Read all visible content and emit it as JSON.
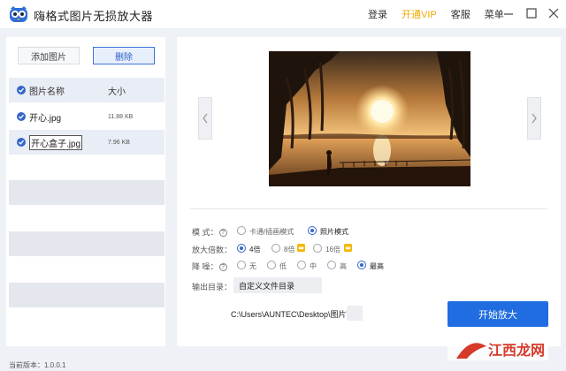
{
  "app": {
    "title": "嗨格式图片无损放大器",
    "nav": {
      "login": "登录",
      "vip": "开通VIP",
      "service": "客服",
      "menu": "菜单"
    }
  },
  "left": {
    "add_label": "添加图片",
    "delete_label": "删除",
    "header_name": "图片名称",
    "header_size": "大小",
    "files": [
      {
        "name": "开心.jpg",
        "size": "11.88 KB"
      },
      {
        "name": "开心盒子.jpg",
        "size": "7.96 KB"
      }
    ]
  },
  "options": {
    "mode_label": "模 式：",
    "mode_options": [
      "卡通/插画模式",
      "照片模式"
    ],
    "mode_selected": "照片模式",
    "scale_label": "放大倍数：",
    "scale_options": [
      "4倍",
      "8倍",
      "16倍"
    ],
    "scale_selected": "4倍",
    "noise_label": "降 噪：",
    "noise_options": [
      "无",
      "低",
      "中",
      "高",
      "最高"
    ],
    "noise_selected": "最高",
    "output_label": "输出目录：",
    "output_btn": "自定义文件目录",
    "output_path": "C:\\Users\\AUNTEC\\Desktop\\图片\\",
    "start_label": "开始放大"
  },
  "footer": {
    "version": "当前版本：1.0.0.1"
  },
  "watermark": {
    "text": "江西龙网"
  },
  "colors": {
    "accent": "#1f6de0",
    "vip": "#f0a800",
    "panel_bg": "#eef1f6"
  }
}
